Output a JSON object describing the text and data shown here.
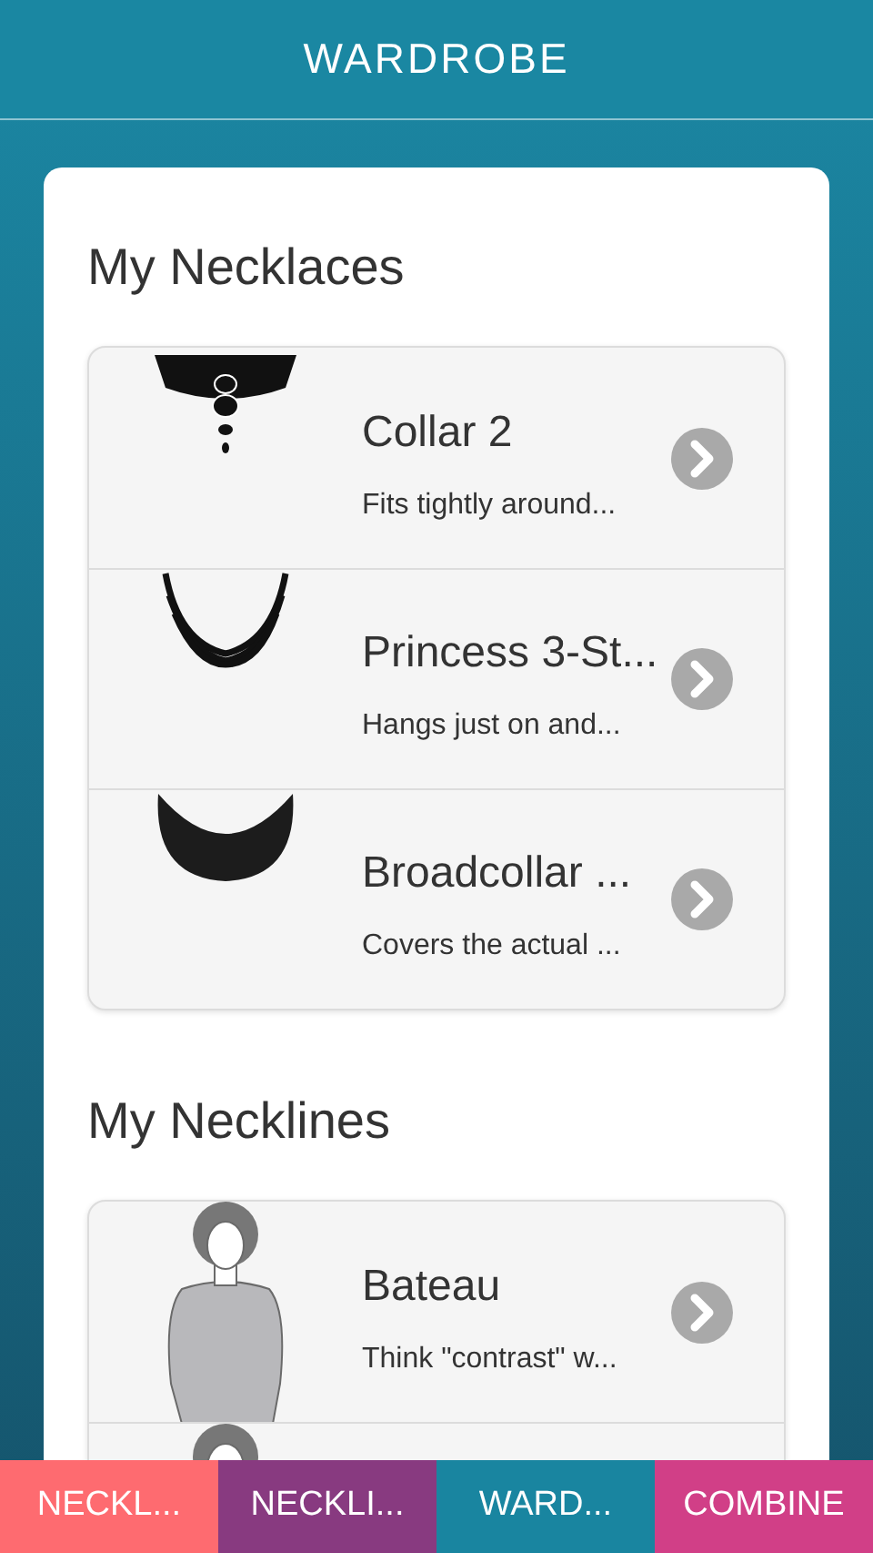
{
  "header": {
    "title": "WARDROBE"
  },
  "sections": [
    {
      "heading": "My Necklaces",
      "items": [
        {
          "kind": "collar",
          "title": "Collar 2",
          "description": "Fits tightly around..."
        },
        {
          "kind": "strands",
          "title": "Princess 3-St...",
          "description": "Hangs just on and..."
        },
        {
          "kind": "bib",
          "title": "Broadcollar ...",
          "description": "Covers the actual ..."
        }
      ]
    },
    {
      "heading": "My Necklines",
      "items": [
        {
          "kind": "figure",
          "title": "Bateau",
          "description": "Think \"contrast\" w..."
        },
        {
          "kind": "figure"
        }
      ]
    }
  ],
  "tabs": [
    {
      "label": "NECKL...",
      "color": "#fe6b70"
    },
    {
      "label": "NECKLI...",
      "color": "#883a80"
    },
    {
      "label": "WARD...",
      "color": "#1985a0"
    },
    {
      "label": "COMBINE",
      "color": "#d13f87"
    }
  ]
}
